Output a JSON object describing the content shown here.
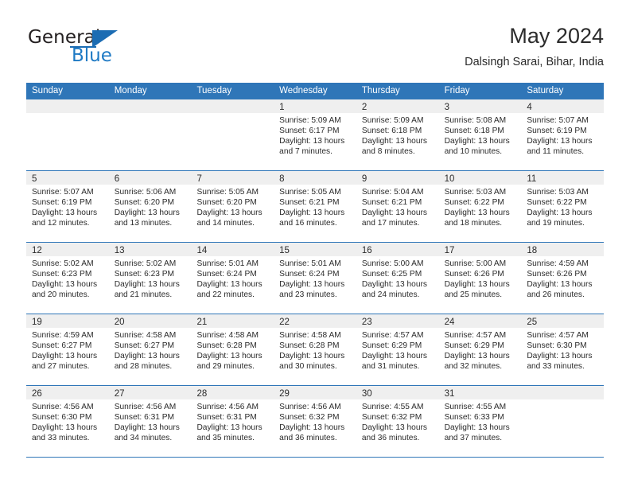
{
  "logo": {
    "word_top": "General",
    "word_bottom": "Blue"
  },
  "header": {
    "title": "May 2024",
    "subtitle": "Dalsingh Sarai, Bihar, India"
  },
  "weekdays": [
    "Sunday",
    "Monday",
    "Tuesday",
    "Wednesday",
    "Thursday",
    "Friday",
    "Saturday"
  ],
  "colors": {
    "header_blue": "#2f76b8",
    "logo_blue": "#1f7ac4",
    "day_band_gray": "#efefef",
    "text": "#2b2b2b"
  },
  "weeks": [
    [
      {
        "day": "",
        "empty": true
      },
      {
        "day": "",
        "empty": true
      },
      {
        "day": "",
        "empty": true
      },
      {
        "day": "1",
        "sunrise": "Sunrise: 5:09 AM",
        "sunset": "Sunset: 6:17 PM",
        "daylight": "Daylight: 13 hours and 7 minutes."
      },
      {
        "day": "2",
        "sunrise": "Sunrise: 5:09 AM",
        "sunset": "Sunset: 6:18 PM",
        "daylight": "Daylight: 13 hours and 8 minutes."
      },
      {
        "day": "3",
        "sunrise": "Sunrise: 5:08 AM",
        "sunset": "Sunset: 6:18 PM",
        "daylight": "Daylight: 13 hours and 10 minutes."
      },
      {
        "day": "4",
        "sunrise": "Sunrise: 5:07 AM",
        "sunset": "Sunset: 6:19 PM",
        "daylight": "Daylight: 13 hours and 11 minutes."
      }
    ],
    [
      {
        "day": "5",
        "sunrise": "Sunrise: 5:07 AM",
        "sunset": "Sunset: 6:19 PM",
        "daylight": "Daylight: 13 hours and 12 minutes."
      },
      {
        "day": "6",
        "sunrise": "Sunrise: 5:06 AM",
        "sunset": "Sunset: 6:20 PM",
        "daylight": "Daylight: 13 hours and 13 minutes."
      },
      {
        "day": "7",
        "sunrise": "Sunrise: 5:05 AM",
        "sunset": "Sunset: 6:20 PM",
        "daylight": "Daylight: 13 hours and 14 minutes."
      },
      {
        "day": "8",
        "sunrise": "Sunrise: 5:05 AM",
        "sunset": "Sunset: 6:21 PM",
        "daylight": "Daylight: 13 hours and 16 minutes."
      },
      {
        "day": "9",
        "sunrise": "Sunrise: 5:04 AM",
        "sunset": "Sunset: 6:21 PM",
        "daylight": "Daylight: 13 hours and 17 minutes."
      },
      {
        "day": "10",
        "sunrise": "Sunrise: 5:03 AM",
        "sunset": "Sunset: 6:22 PM",
        "daylight": "Daylight: 13 hours and 18 minutes."
      },
      {
        "day": "11",
        "sunrise": "Sunrise: 5:03 AM",
        "sunset": "Sunset: 6:22 PM",
        "daylight": "Daylight: 13 hours and 19 minutes."
      }
    ],
    [
      {
        "day": "12",
        "sunrise": "Sunrise: 5:02 AM",
        "sunset": "Sunset: 6:23 PM",
        "daylight": "Daylight: 13 hours and 20 minutes."
      },
      {
        "day": "13",
        "sunrise": "Sunrise: 5:02 AM",
        "sunset": "Sunset: 6:23 PM",
        "daylight": "Daylight: 13 hours and 21 minutes."
      },
      {
        "day": "14",
        "sunrise": "Sunrise: 5:01 AM",
        "sunset": "Sunset: 6:24 PM",
        "daylight": "Daylight: 13 hours and 22 minutes."
      },
      {
        "day": "15",
        "sunrise": "Sunrise: 5:01 AM",
        "sunset": "Sunset: 6:24 PM",
        "daylight": "Daylight: 13 hours and 23 minutes."
      },
      {
        "day": "16",
        "sunrise": "Sunrise: 5:00 AM",
        "sunset": "Sunset: 6:25 PM",
        "daylight": "Daylight: 13 hours and 24 minutes."
      },
      {
        "day": "17",
        "sunrise": "Sunrise: 5:00 AM",
        "sunset": "Sunset: 6:26 PM",
        "daylight": "Daylight: 13 hours and 25 minutes."
      },
      {
        "day": "18",
        "sunrise": "Sunrise: 4:59 AM",
        "sunset": "Sunset: 6:26 PM",
        "daylight": "Daylight: 13 hours and 26 minutes."
      }
    ],
    [
      {
        "day": "19",
        "sunrise": "Sunrise: 4:59 AM",
        "sunset": "Sunset: 6:27 PM",
        "daylight": "Daylight: 13 hours and 27 minutes."
      },
      {
        "day": "20",
        "sunrise": "Sunrise: 4:58 AM",
        "sunset": "Sunset: 6:27 PM",
        "daylight": "Daylight: 13 hours and 28 minutes."
      },
      {
        "day": "21",
        "sunrise": "Sunrise: 4:58 AM",
        "sunset": "Sunset: 6:28 PM",
        "daylight": "Daylight: 13 hours and 29 minutes."
      },
      {
        "day": "22",
        "sunrise": "Sunrise: 4:58 AM",
        "sunset": "Sunset: 6:28 PM",
        "daylight": "Daylight: 13 hours and 30 minutes."
      },
      {
        "day": "23",
        "sunrise": "Sunrise: 4:57 AM",
        "sunset": "Sunset: 6:29 PM",
        "daylight": "Daylight: 13 hours and 31 minutes."
      },
      {
        "day": "24",
        "sunrise": "Sunrise: 4:57 AM",
        "sunset": "Sunset: 6:29 PM",
        "daylight": "Daylight: 13 hours and 32 minutes."
      },
      {
        "day": "25",
        "sunrise": "Sunrise: 4:57 AM",
        "sunset": "Sunset: 6:30 PM",
        "daylight": "Daylight: 13 hours and 33 minutes."
      }
    ],
    [
      {
        "day": "26",
        "sunrise": "Sunrise: 4:56 AM",
        "sunset": "Sunset: 6:30 PM",
        "daylight": "Daylight: 13 hours and 33 minutes."
      },
      {
        "day": "27",
        "sunrise": "Sunrise: 4:56 AM",
        "sunset": "Sunset: 6:31 PM",
        "daylight": "Daylight: 13 hours and 34 minutes."
      },
      {
        "day": "28",
        "sunrise": "Sunrise: 4:56 AM",
        "sunset": "Sunset: 6:31 PM",
        "daylight": "Daylight: 13 hours and 35 minutes."
      },
      {
        "day": "29",
        "sunrise": "Sunrise: 4:56 AM",
        "sunset": "Sunset: 6:32 PM",
        "daylight": "Daylight: 13 hours and 36 minutes."
      },
      {
        "day": "30",
        "sunrise": "Sunrise: 4:55 AM",
        "sunset": "Sunset: 6:32 PM",
        "daylight": "Daylight: 13 hours and 36 minutes."
      },
      {
        "day": "31",
        "sunrise": "Sunrise: 4:55 AM",
        "sunset": "Sunset: 6:33 PM",
        "daylight": "Daylight: 13 hours and 37 minutes."
      },
      {
        "day": "",
        "empty": true
      }
    ]
  ]
}
